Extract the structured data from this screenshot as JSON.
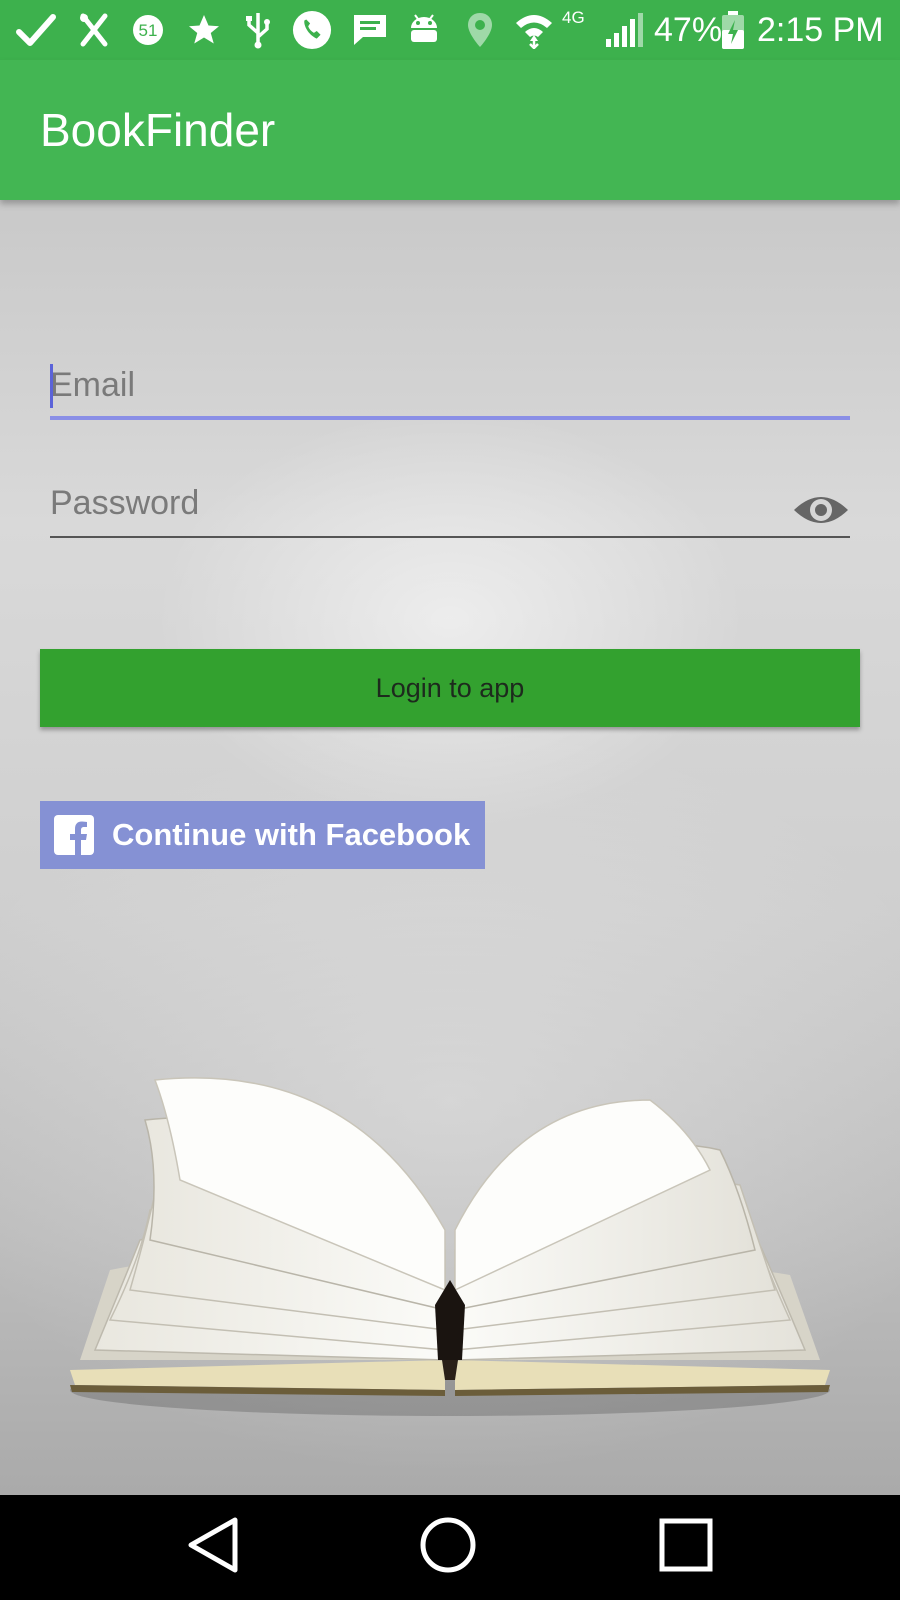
{
  "status_bar": {
    "battery_text": "47%",
    "time": "2:15 PM",
    "network_label": "4G",
    "notification_badge": "51",
    "icons": [
      "check-icon",
      "tools-icon",
      "badge-icon",
      "star-icon",
      "usb-icon",
      "phone-icon",
      "message-icon",
      "android-icon",
      "location-icon",
      "wifi-icon",
      "signal-icon",
      "battery-icon"
    ]
  },
  "app_bar": {
    "title": "BookFinder"
  },
  "login_form": {
    "email_placeholder": "Email",
    "password_placeholder": "Password",
    "login_label": "Login to app",
    "facebook_label": "Continue with Facebook"
  },
  "colors": {
    "status_bar": "#3DB14D",
    "app_bar": "#43B653",
    "login_button": "#33A12F",
    "facebook_button": "#8591D4",
    "email_underline_focus": "#8A8FE6"
  },
  "nav_bar": {
    "icons": [
      "back-icon",
      "home-icon",
      "recents-icon"
    ]
  }
}
